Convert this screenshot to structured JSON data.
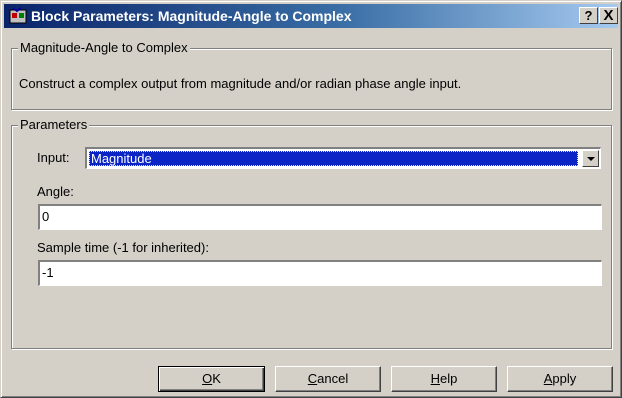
{
  "window": {
    "title": "Block Parameters: Magnitude-Angle to Complex",
    "help_glyph": "?",
    "close_glyph": "X"
  },
  "block_group": {
    "title": "Magnitude-Angle to Complex",
    "description": "Construct a complex output from magnitude and/or radian phase angle input."
  },
  "params_group": {
    "title": "Parameters",
    "input_label": "Input:",
    "input_value": "Magnitude",
    "angle_label": "Angle:",
    "angle_value": "0",
    "sample_label": "Sample time (-1 for inherited):",
    "sample_value": "-1"
  },
  "buttons": {
    "ok": {
      "first": "O",
      "rest": "K"
    },
    "cancel": {
      "first": "C",
      "rest": "ancel"
    },
    "help": {
      "first": "H",
      "rest": "elp"
    },
    "apply": {
      "first": "A",
      "rest": "pply"
    }
  },
  "colors": {
    "title_gradient_start": "#0a246a",
    "title_gradient_end": "#a6caf0",
    "face": "#d4d0c8",
    "selection": "#0a24c6"
  },
  "icons": {
    "app": "simulink-block-icon",
    "dropdown": "chevron-down-icon"
  }
}
